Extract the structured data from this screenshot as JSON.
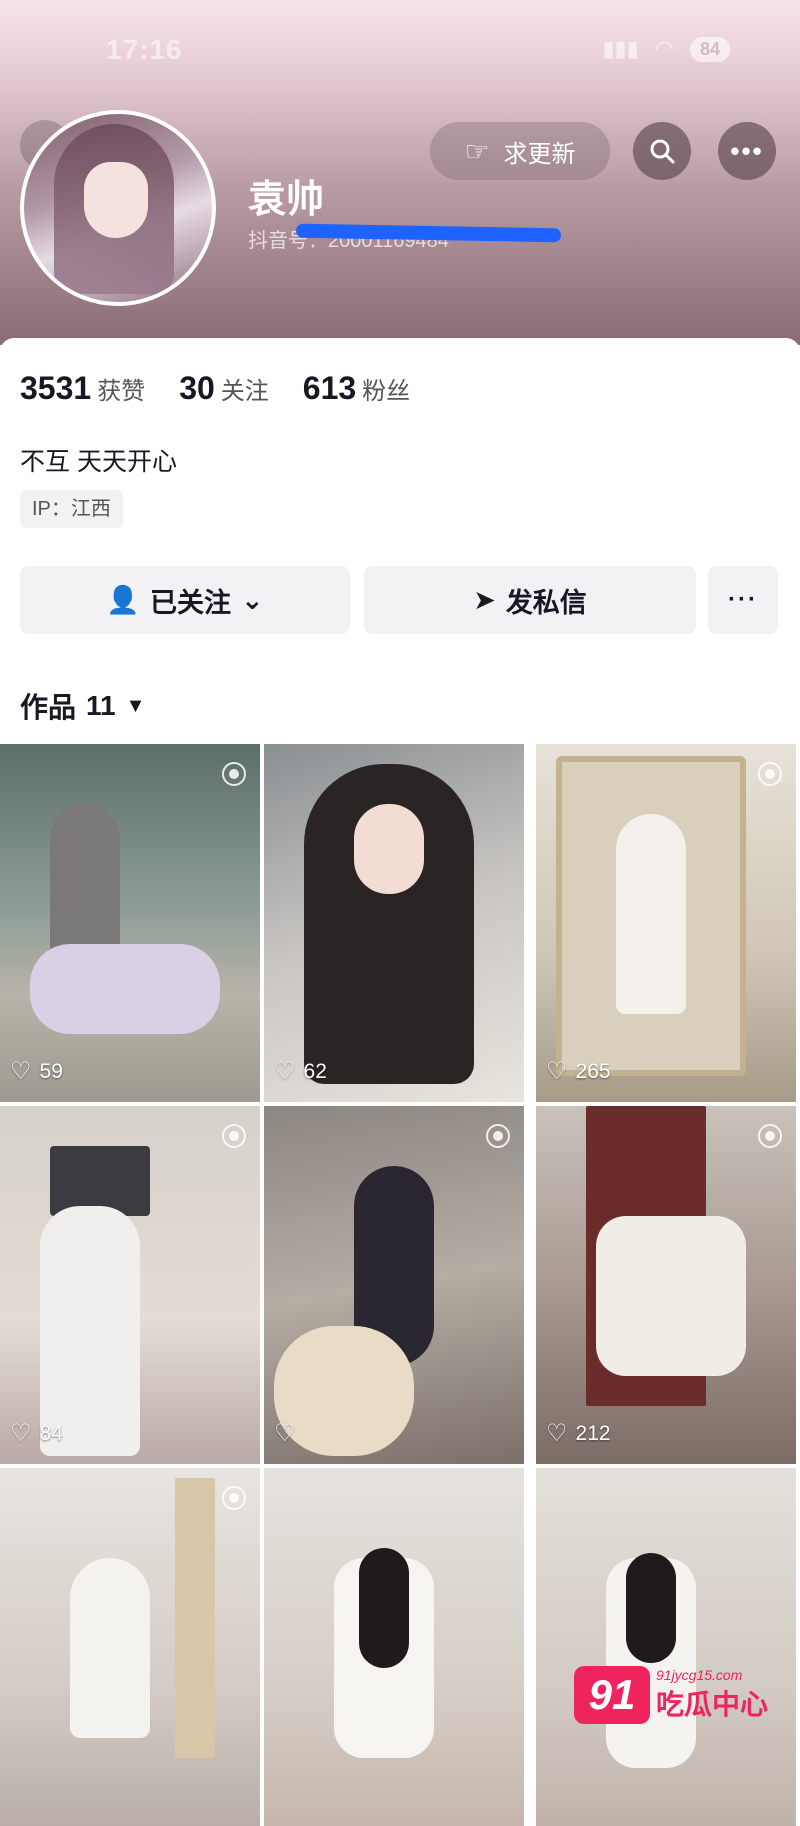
{
  "status_bar": {
    "time": "17:16",
    "battery": "84"
  },
  "header": {
    "request_update_label": "求更新",
    "search_icon": "search-icon",
    "more_icon": "more-icon"
  },
  "profile": {
    "name": "袁帅",
    "douyin_id": "抖音号：20001169484"
  },
  "stats": [
    {
      "num": "3531",
      "label": "获赞"
    },
    {
      "num": "30",
      "label": "关注"
    },
    {
      "num": "613",
      "label": "粉丝"
    }
  ],
  "bio": "不互 天天开心",
  "ip": "IP：江西",
  "actions": {
    "followed_label": "已关注",
    "message_label": "发私信",
    "more_label": "···"
  },
  "works": {
    "label": "作品",
    "count": "11"
  },
  "grid": [
    {
      "likes": "59"
    },
    {
      "likes": "62"
    },
    {
      "likes": "265"
    },
    {
      "likes": "84"
    },
    {
      "likes": ""
    },
    {
      "likes": "212"
    },
    {
      "likes": ""
    },
    {
      "likes": ""
    },
    {
      "likes": ""
    }
  ],
  "watermark": {
    "logo": "91",
    "url": "91jycg15.com",
    "name": "吃瓜中心"
  }
}
